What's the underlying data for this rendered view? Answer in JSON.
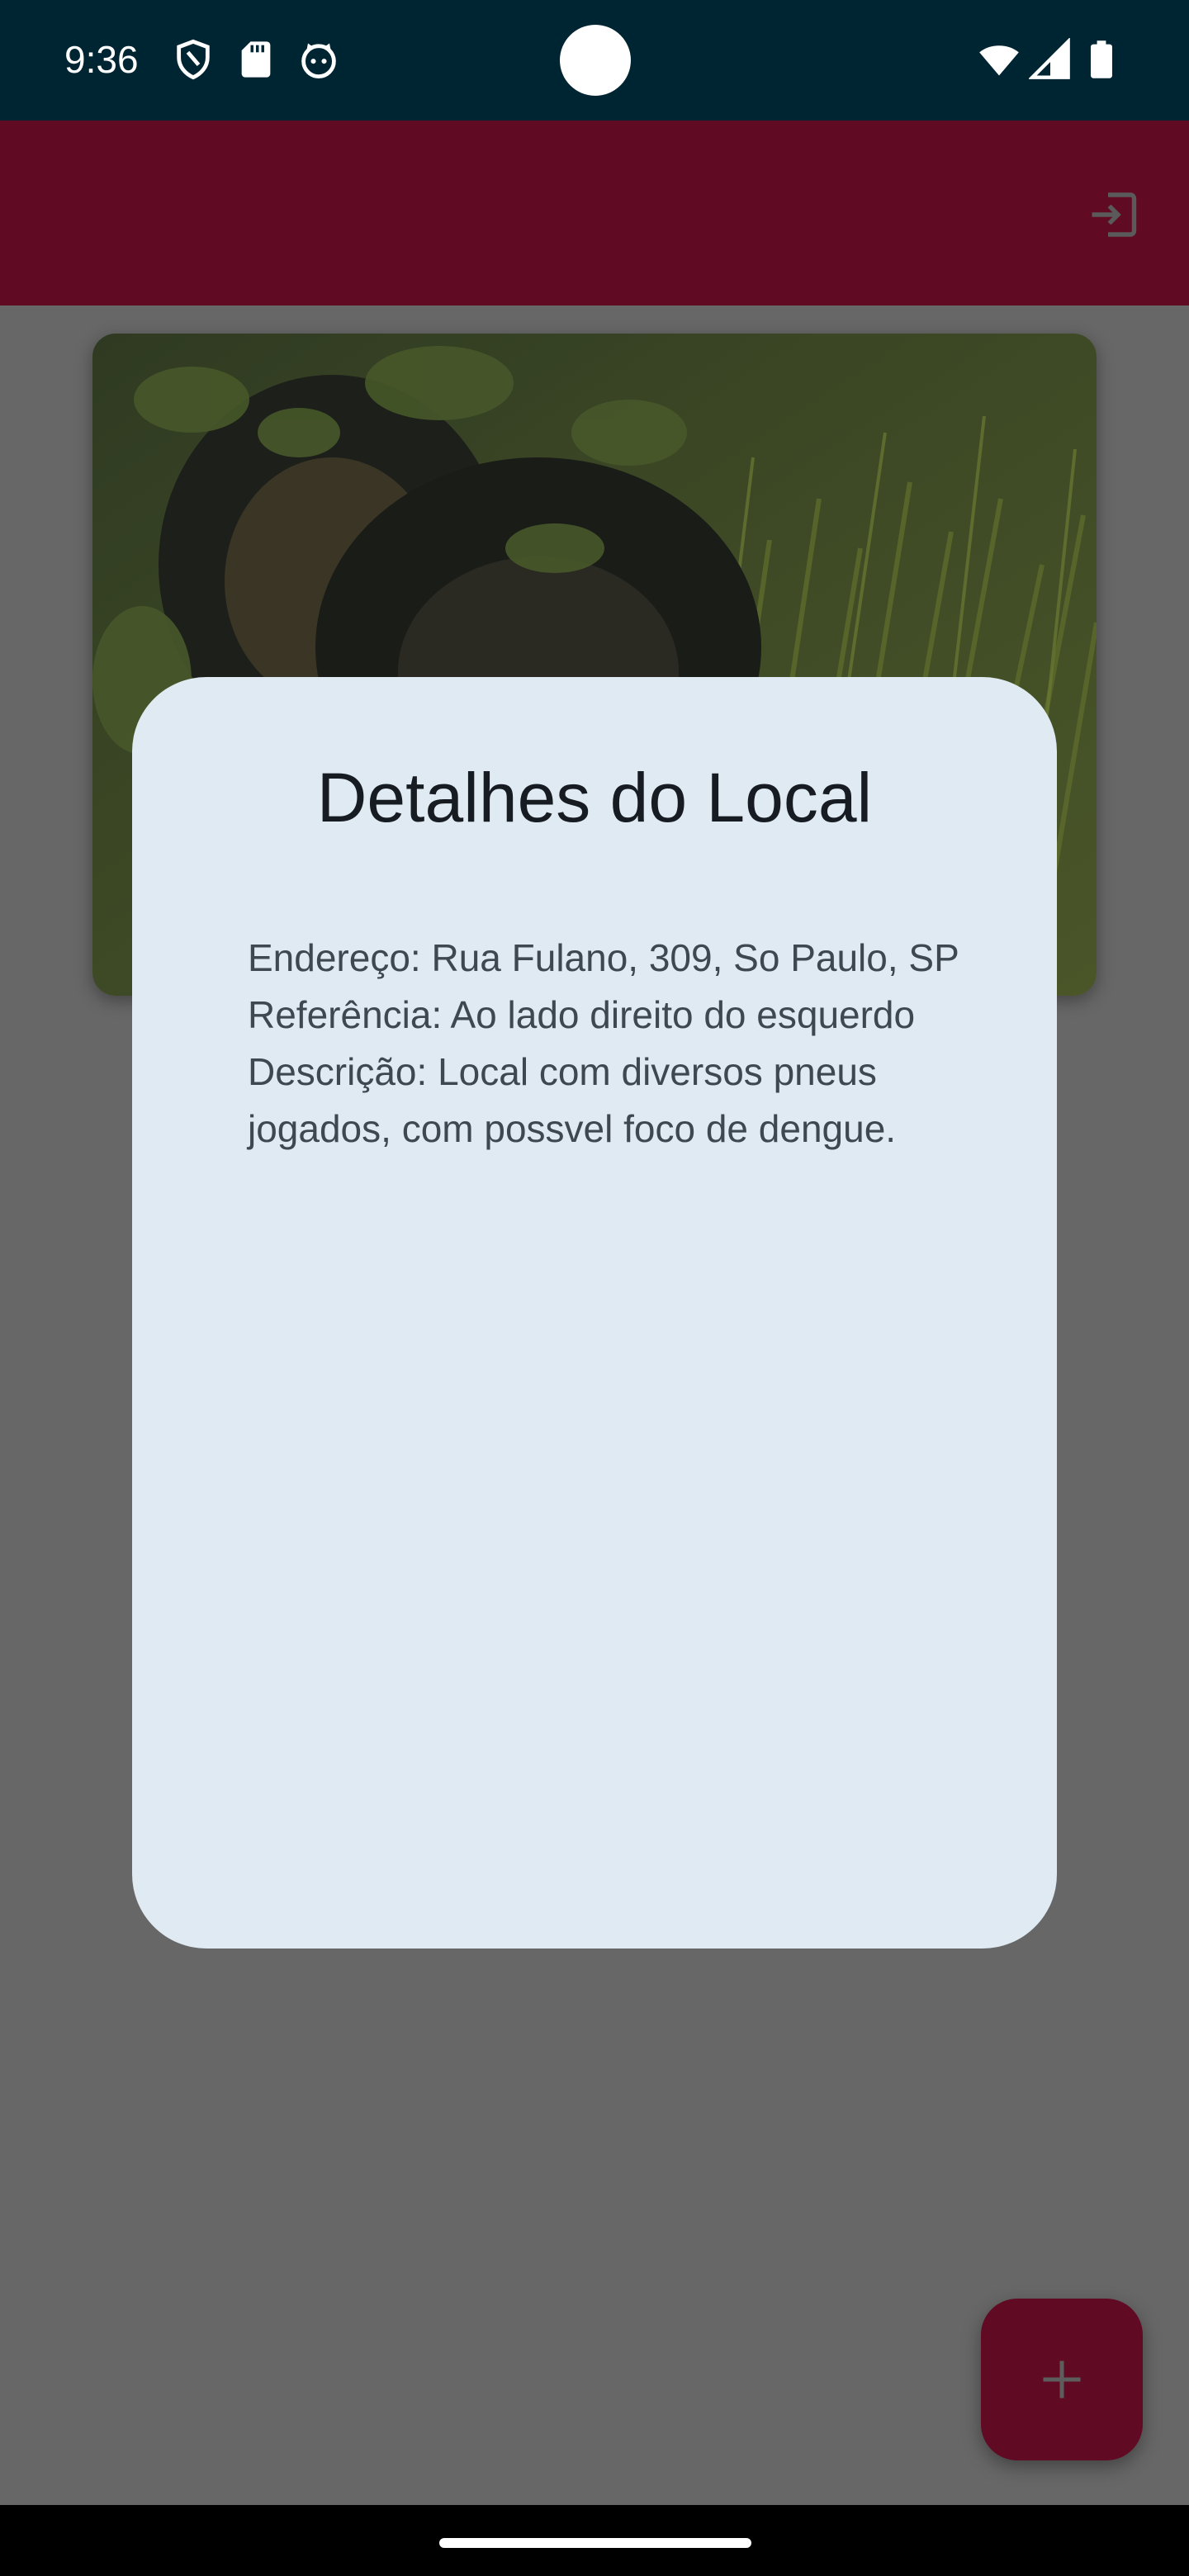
{
  "status_bar": {
    "time": "9:36",
    "left_icons": [
      "shield-icon",
      "sd-card-icon",
      "cat-icon"
    ],
    "right_icons": [
      "wifi-icon",
      "signal-icon",
      "battery-icon"
    ]
  },
  "app_bar": {
    "color": "#600a24",
    "action_icon": "logout-icon"
  },
  "dialog": {
    "title": "Detalhes do Local",
    "address": "Endereço: Rua Fulano, 309, So Paulo, SP",
    "reference": "Referência: Ao lado direito do esquerdo",
    "description": "Descrição: Local com diversos pneus jogados, com possvel foco de dengue."
  },
  "fab": {
    "icon": "plus-icon",
    "color": "#600a24"
  },
  "colors": {
    "status_bar": "#002532",
    "scrim_background": "#676767",
    "dialog_background": "#dfeaf2"
  }
}
